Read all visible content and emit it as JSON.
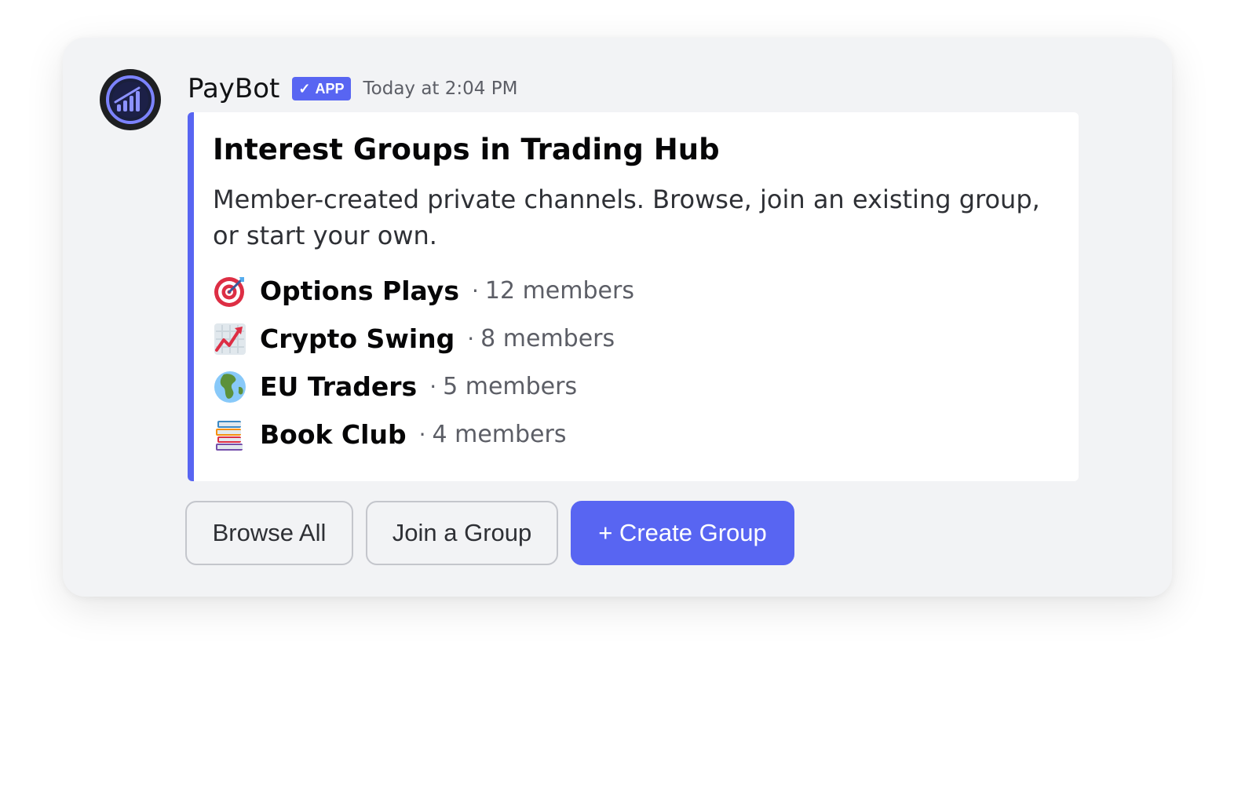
{
  "message": {
    "author": "PayBot",
    "badge": {
      "check": "✓",
      "label": "APP",
      "color": "#5865f2"
    },
    "timestamp": "Today at 2:04 PM"
  },
  "embed": {
    "accent_color": "#5865f2",
    "title": "Interest Groups in Trading Hub",
    "description": "Member-created private channels. Browse, join an existing group, or start your own.",
    "groups": [
      {
        "icon": "target-icon",
        "name": "Options Plays",
        "separator": "·",
        "members": "12 members"
      },
      {
        "icon": "chart-increasing-icon",
        "name": "Crypto Swing",
        "separator": "·",
        "members": "8 members"
      },
      {
        "icon": "globe-icon",
        "name": "EU Traders",
        "separator": "·",
        "members": "5 members"
      },
      {
        "icon": "books-icon",
        "name": "Book Club",
        "separator": "·",
        "members": "4 members"
      }
    ]
  },
  "buttons": {
    "browse_all": "Browse All",
    "join_group": "Join a Group",
    "create_group": "+ Create Group"
  }
}
